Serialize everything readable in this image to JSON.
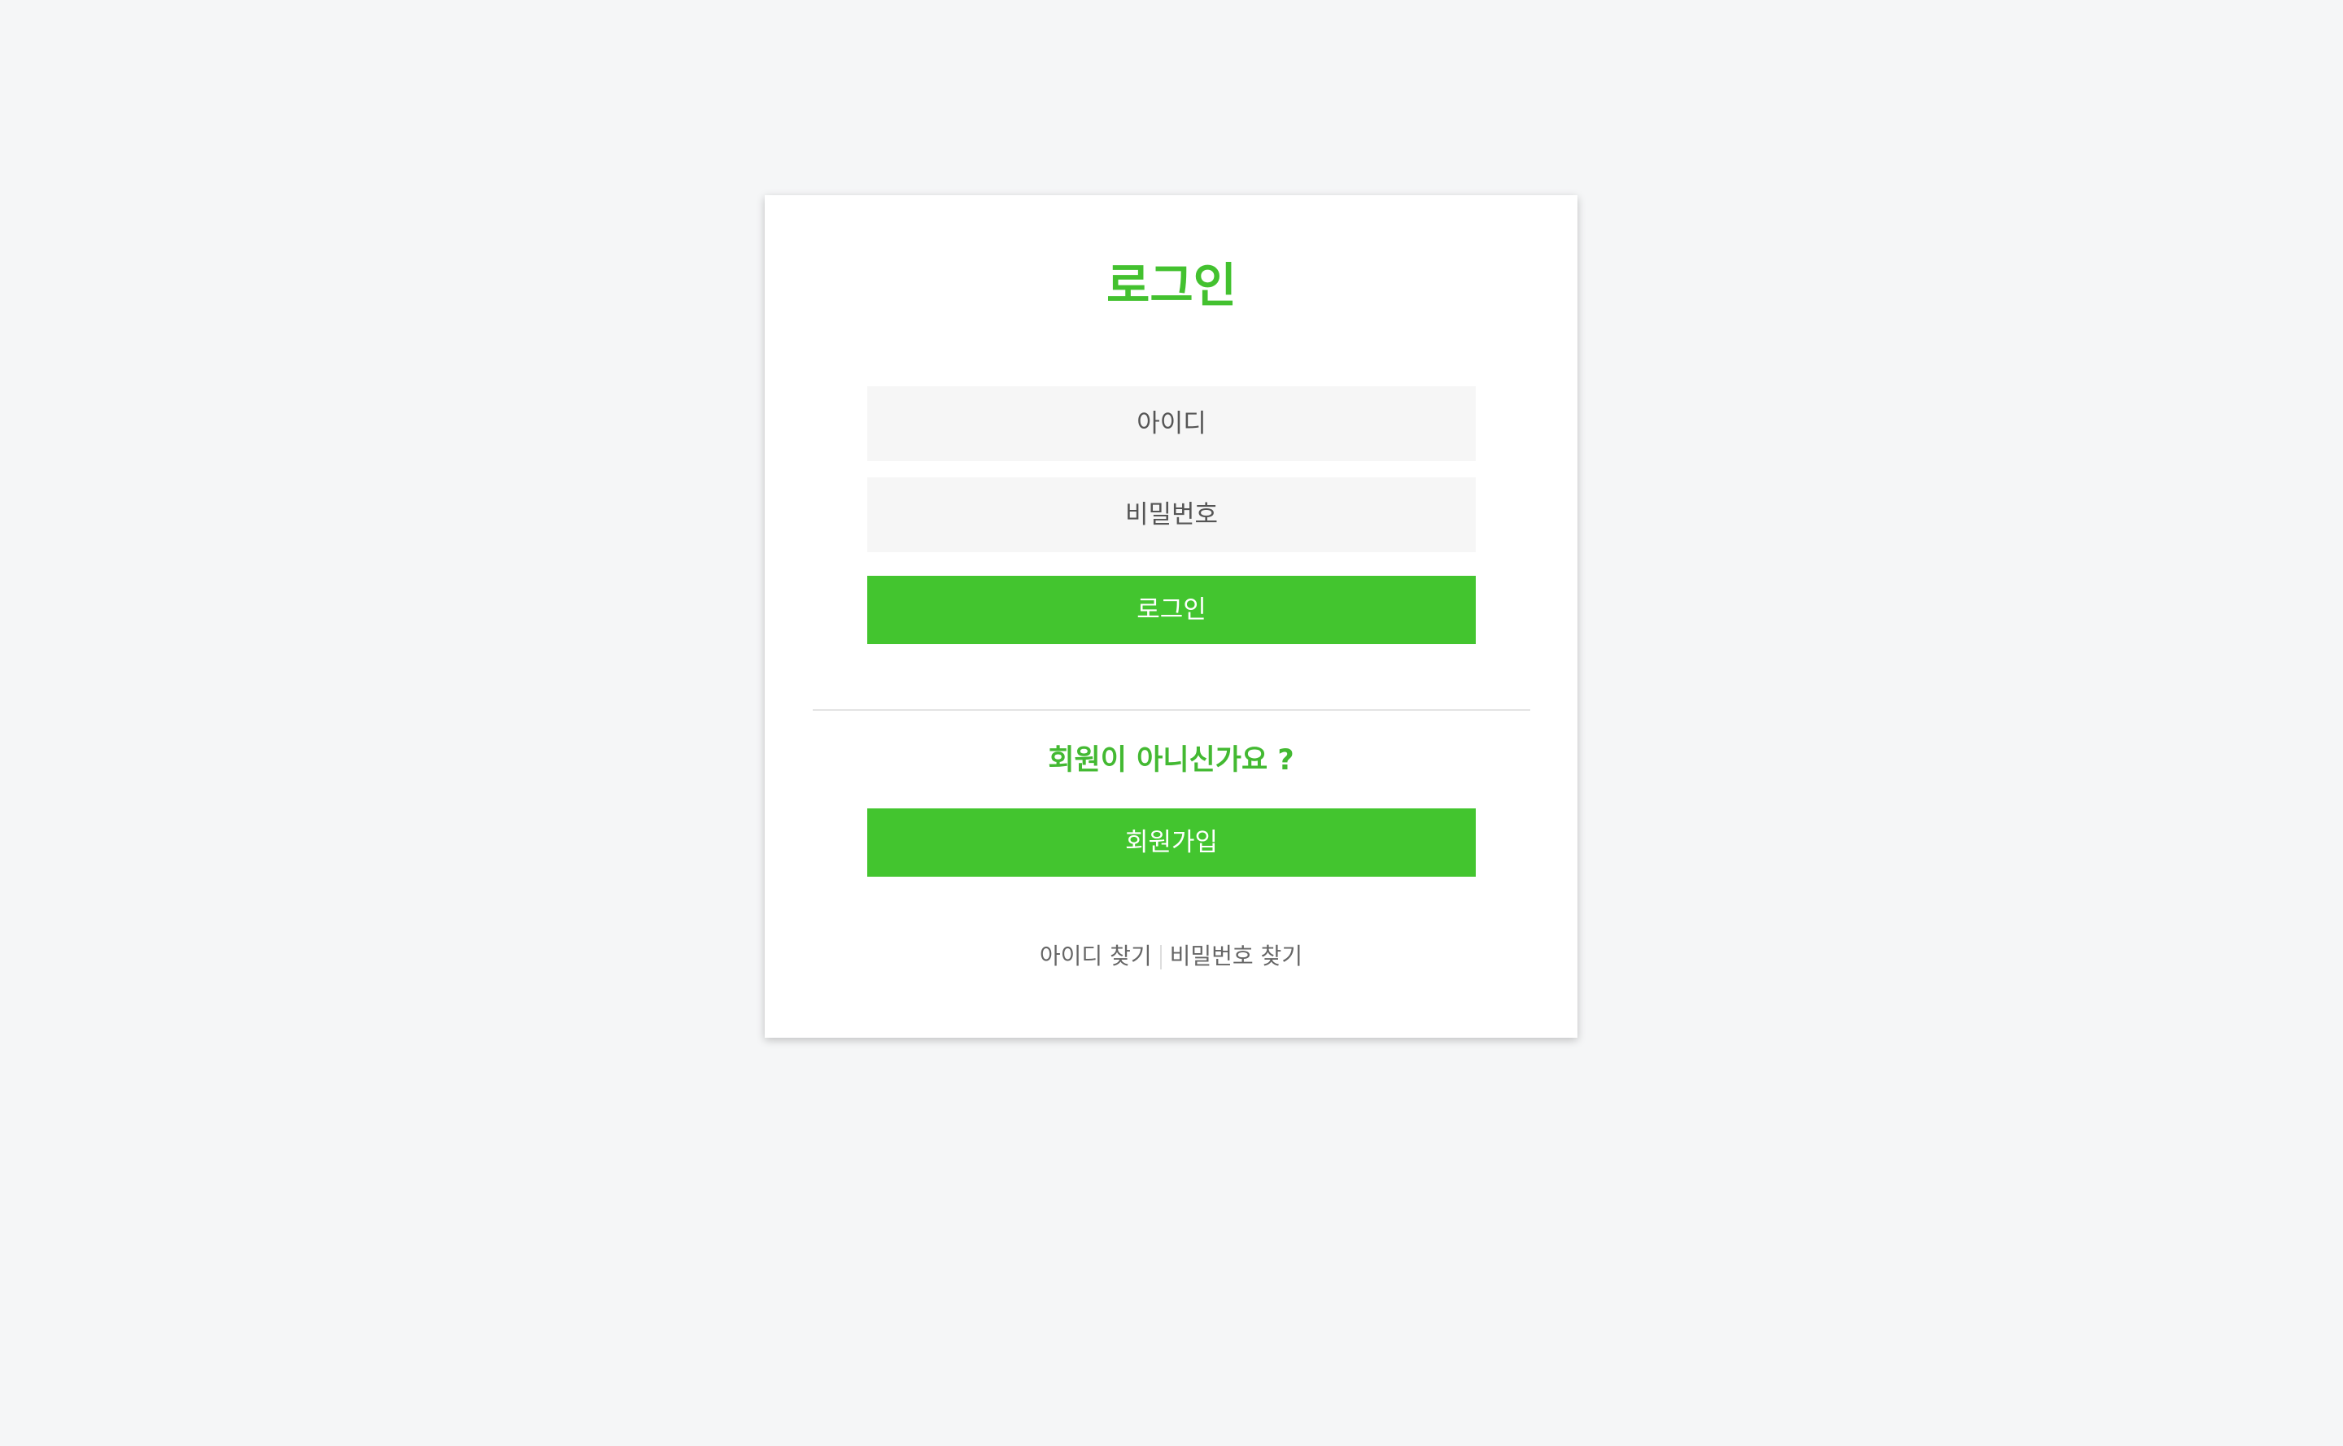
{
  "login": {
    "title": "로그인",
    "id_placeholder": "아이디",
    "password_placeholder": "비밀번호",
    "submit_label": "로그인"
  },
  "signup": {
    "prompt": "회원이 아니신가요 ?",
    "button_label": "회원가입"
  },
  "links": {
    "find_id": "아이디 찾기",
    "find_password": "비밀번호 찾기"
  },
  "colors": {
    "accent": "#43c52f",
    "background": "#f5f6f7",
    "input_background": "#f6f6f6"
  }
}
